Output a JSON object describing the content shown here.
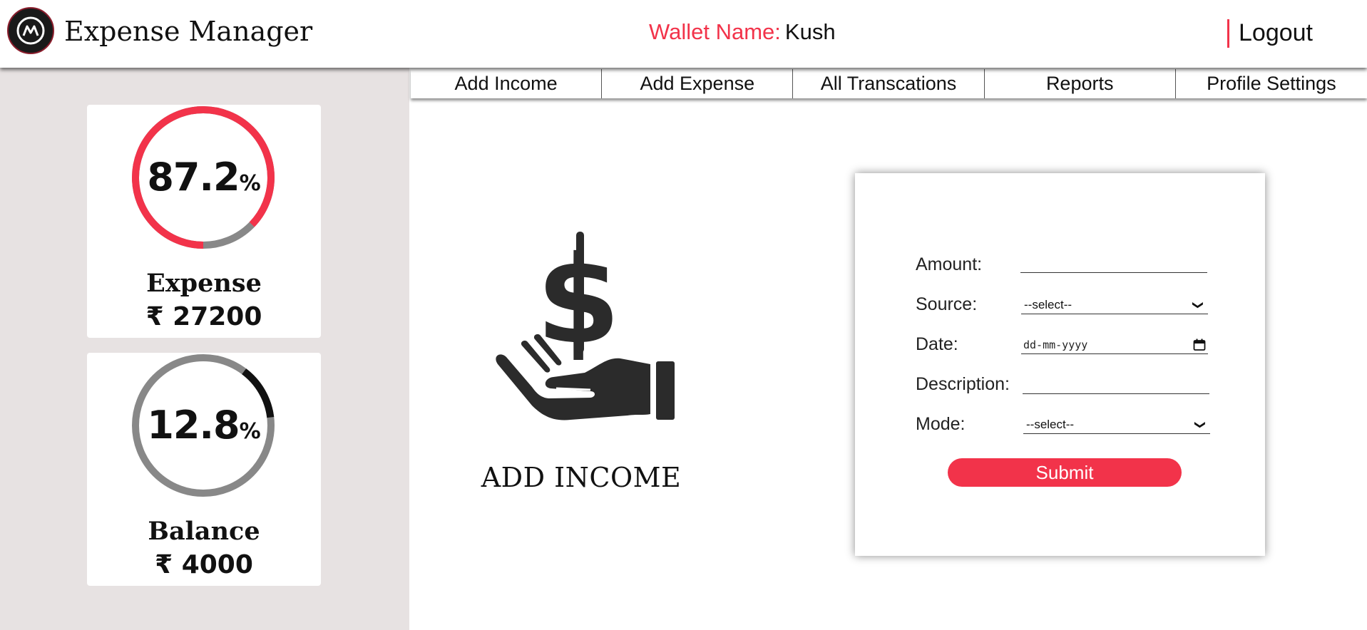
{
  "header": {
    "app_title": "Expense Manager",
    "wallet_label": "Wallet Name:",
    "wallet_name": "Kush",
    "logout_label": "Logout"
  },
  "nav": {
    "tabs": [
      {
        "label": "Add Income"
      },
      {
        "label": "Add Expense"
      },
      {
        "label": "All Transcations"
      },
      {
        "label": "Reports"
      },
      {
        "label": "Profile Settings"
      }
    ]
  },
  "sidebar": {
    "expense": {
      "percent": "87.2",
      "percent_sign": "%",
      "ring_fraction": 0.872,
      "label": "Expense",
      "amount": "₹ 27200"
    },
    "balance": {
      "percent": "12.8",
      "percent_sign": "%",
      "ring_fraction": 0.128,
      "label": "Balance",
      "amount": "₹ 4000"
    }
  },
  "hero": {
    "icon": "hand-dollar-icon",
    "title": "ADD INCOME"
  },
  "form": {
    "amount_label": "Amount:",
    "amount_value": "",
    "source_label": "Source:",
    "source_selected": "--select--",
    "date_label": "Date:",
    "date_placeholder": "dd-mm-yyyy",
    "description_label": "Description:",
    "description_value": "",
    "mode_label": "Mode:",
    "mode_selected": "--select--",
    "submit_label": "Submit"
  },
  "colors": {
    "accent": "#f2334a",
    "ring_track": "#888888",
    "balance_arc": "#111111",
    "sidebar_bg": "#e7e2e2"
  }
}
